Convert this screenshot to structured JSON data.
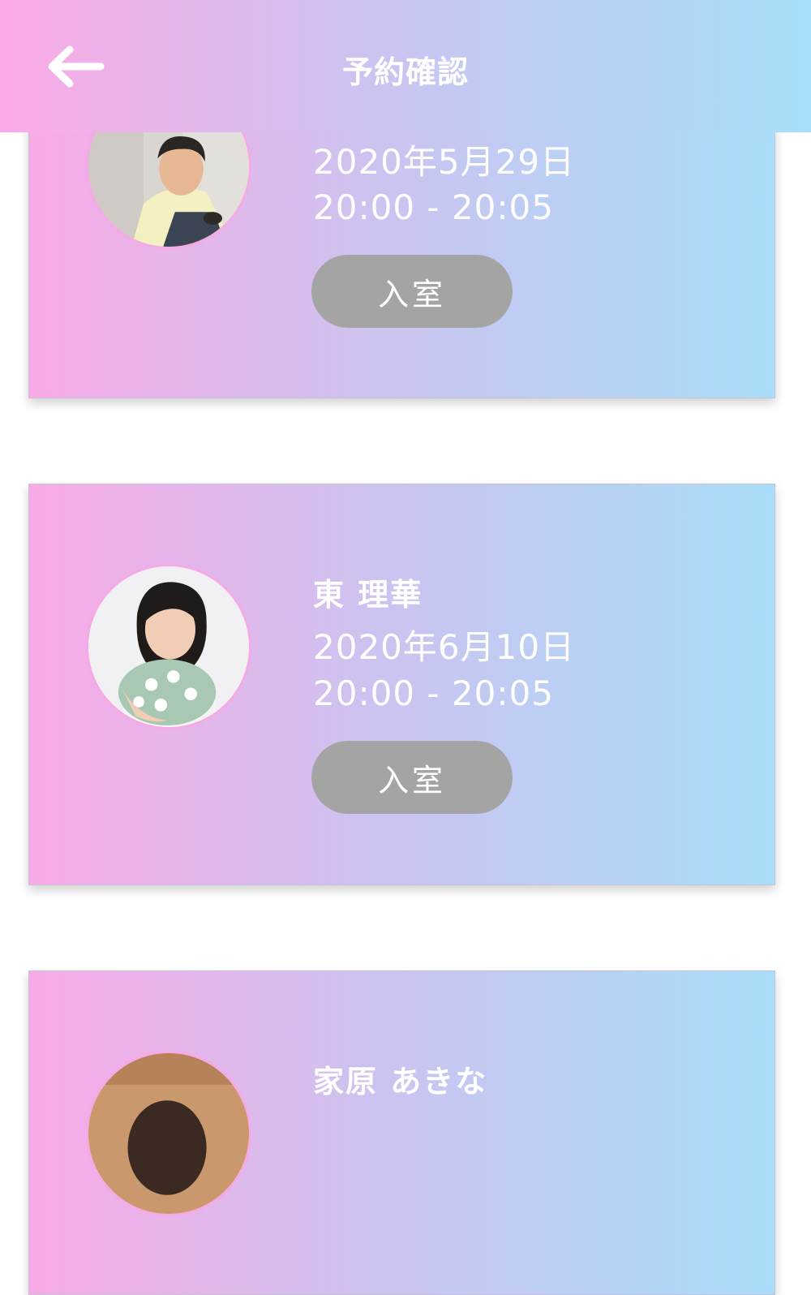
{
  "header": {
    "title": "予約確認",
    "back_icon": "arrow-left-icon"
  },
  "reservations": [
    {
      "name": "",
      "date": "2020年5月29日",
      "time": "20:00 - 20:05",
      "enter_label": "入室"
    },
    {
      "name": "東 理華",
      "date": "2020年6月10日",
      "time": "20:00 - 20:05",
      "enter_label": "入室"
    },
    {
      "name": "家原 あきな",
      "date": "",
      "time": "",
      "enter_label": ""
    }
  ],
  "colors": {
    "gradient_start": "#f8aae6",
    "gradient_end": "#a9ddf9",
    "button_gray": "#a4a4a4",
    "text": "#ffffff"
  }
}
